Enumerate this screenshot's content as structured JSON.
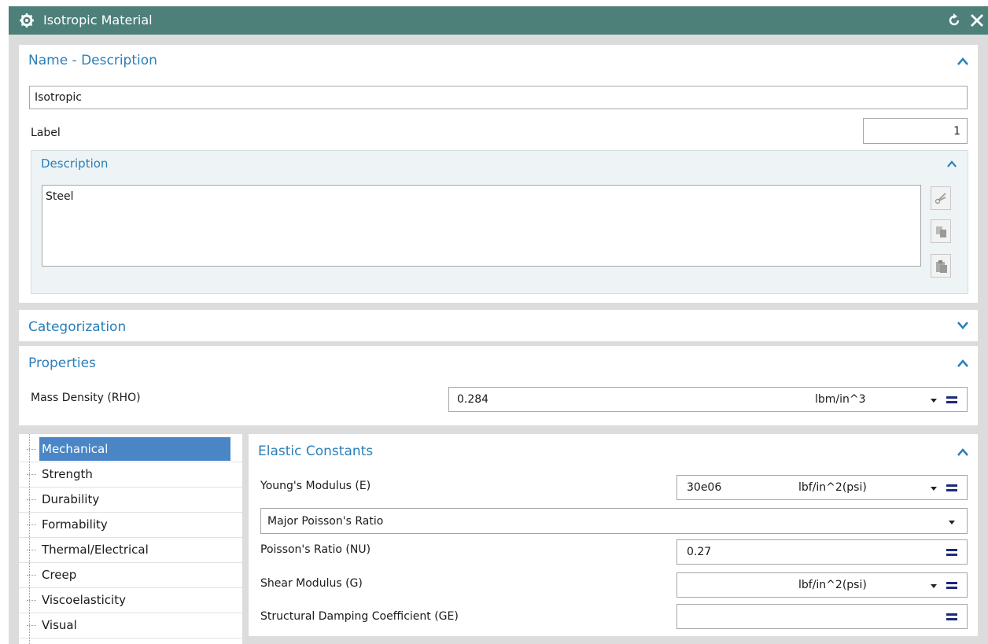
{
  "window": {
    "title": "Isotropic Material",
    "reset_icon": "reset-icon",
    "close_icon": "close-icon",
    "gear_icon": "gear-icon"
  },
  "name_description": {
    "title": "Name - Description",
    "name_value": "Isotropic",
    "label_text": "Label",
    "label_value": "1",
    "description": {
      "title": "Description",
      "text": "Steel"
    },
    "edit_icons": [
      "cut-icon",
      "copy-icon",
      "paste-icon"
    ]
  },
  "categorization": {
    "title": "Categorization"
  },
  "properties": {
    "title": "Properties",
    "mass_density": {
      "label": "Mass Density (RHO)",
      "value": "0.284",
      "unit": "lbm/in^3"
    }
  },
  "tree": {
    "items": [
      "Mechanical",
      "Strength",
      "Durability",
      "Formability",
      "Thermal/Electrical",
      "Creep",
      "Viscoelasticity",
      "Visual"
    ],
    "selected": "Mechanical"
  },
  "elastic": {
    "title": "Elastic Constants",
    "youngs": {
      "label": "Young's Modulus (E)",
      "value": "30e06",
      "unit": "lbf/in^2(psi)"
    },
    "poisson_select": "Major Poisson's Ratio",
    "poisson": {
      "label": "Poisson's Ratio (NU)",
      "value": "0.27"
    },
    "shear": {
      "label": "Shear Modulus (G)",
      "value": "",
      "unit": "lbf/in^2(psi)"
    },
    "damping": {
      "label": "Structural Damping Coefficient (GE)",
      "value": ""
    }
  },
  "colors": {
    "titlebar": "#4c8079",
    "section_title": "#2a7fb8",
    "selection": "#4a86c5",
    "equals_icon": "#1b2a7a"
  }
}
